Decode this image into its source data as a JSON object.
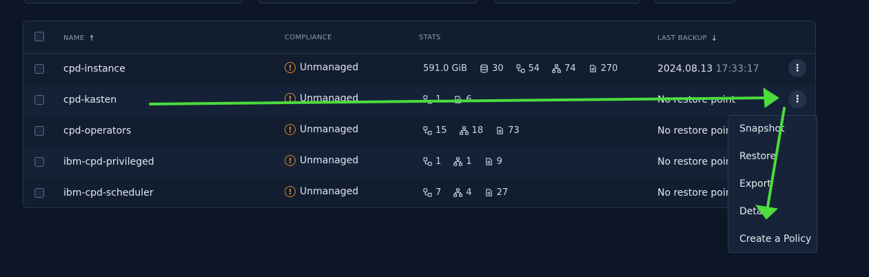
{
  "table": {
    "headers": {
      "name": "NAME",
      "compliance": "COMPLIANCE",
      "stats": "STATS",
      "last_backup": "LAST BACKUP"
    },
    "rows": [
      {
        "name": "cpd-instance",
        "compliance": "Unmanaged",
        "stats": [
          "591.0 GiB",
          "30",
          "54",
          "74",
          "270"
        ],
        "backup_date": "2024.08.13",
        "backup_time": "17:33:17"
      },
      {
        "name": "cpd-kasten",
        "compliance": "Unmanaged",
        "stats": [
          "1",
          "6"
        ],
        "backup_text": "No restore point"
      },
      {
        "name": "cpd-operators",
        "compliance": "Unmanaged",
        "stats": [
          "15",
          "18",
          "73"
        ],
        "backup_text": "No restore point"
      },
      {
        "name": "ibm-cpd-privileged",
        "compliance": "Unmanaged",
        "stats": [
          "1",
          "1",
          "9"
        ],
        "backup_text": "No restore point"
      },
      {
        "name": "ibm-cpd-scheduler",
        "compliance": "Unmanaged",
        "stats": [
          "7",
          "4",
          "27"
        ],
        "backup_text": "No restore point"
      }
    ]
  },
  "context_menu": {
    "items": [
      "Snapshot",
      "Restore",
      "Export",
      "Details",
      "Create a Policy"
    ]
  },
  "colors": {
    "background": "#0d1626",
    "warning": "#e08a2a",
    "annotation_arrow": "#4cdc3c"
  }
}
